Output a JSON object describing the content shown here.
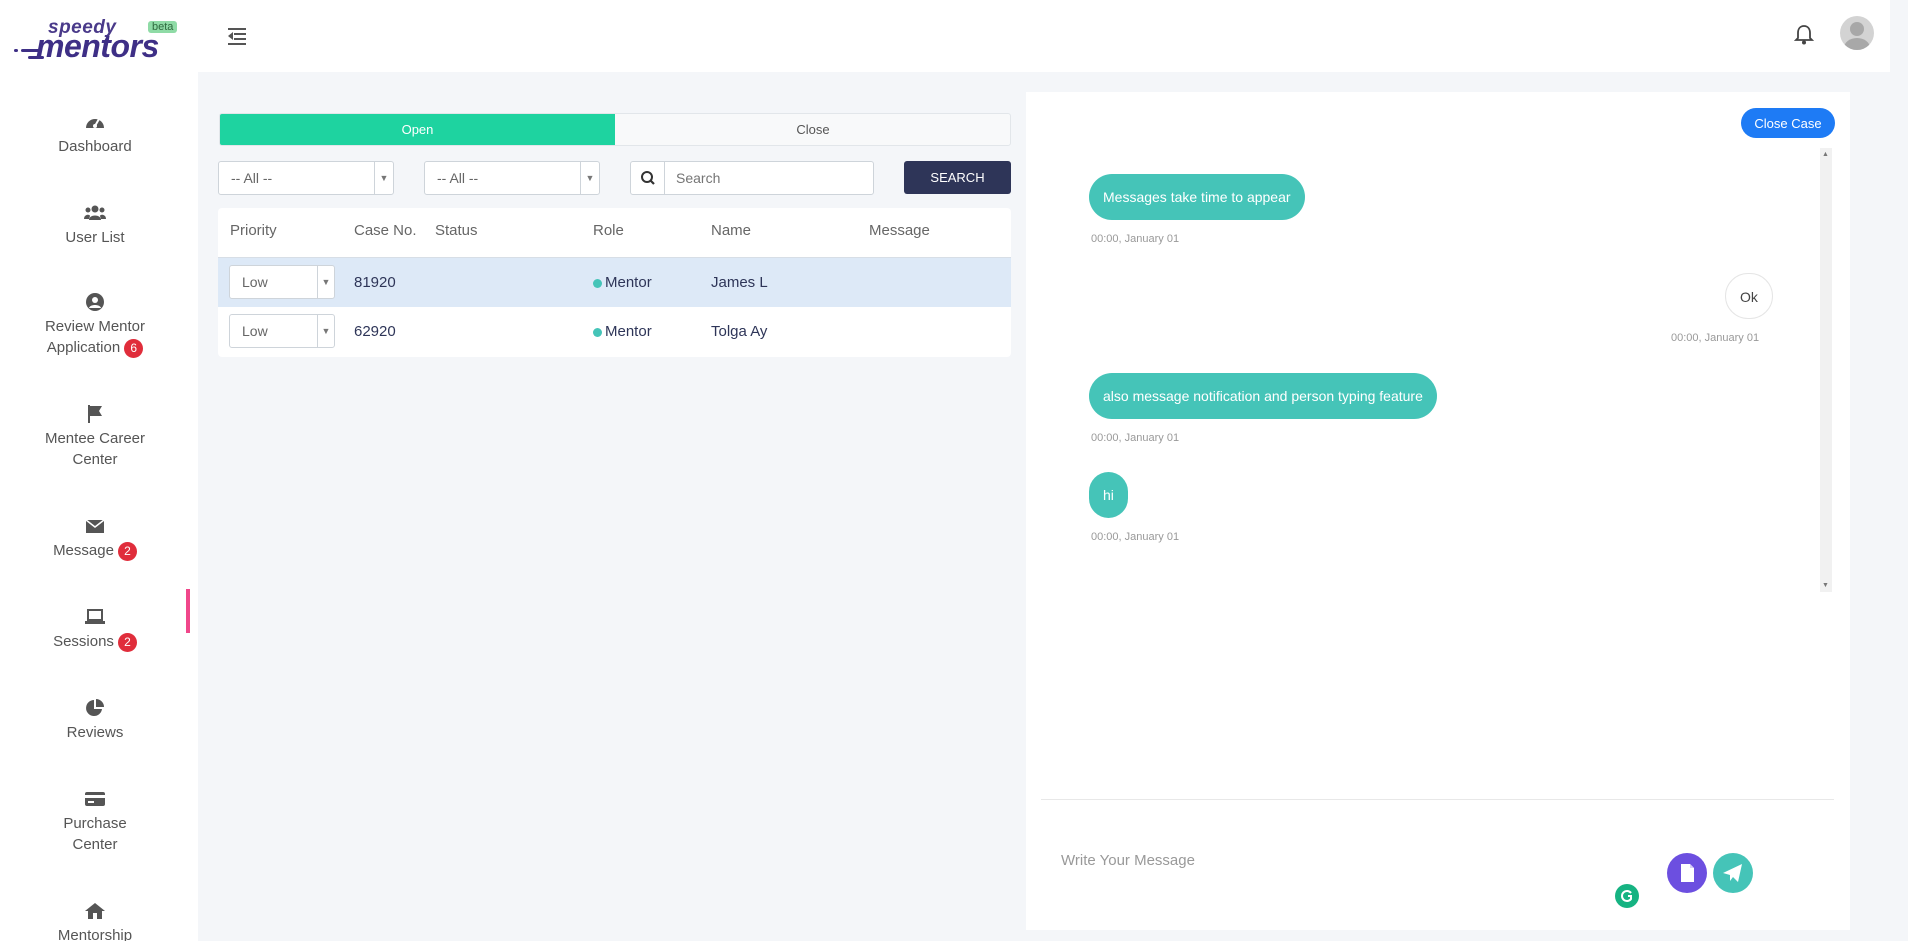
{
  "brand": {
    "logo_top": "speedy",
    "logo_main": "mentors",
    "beta_label": "beta"
  },
  "sidebar": {
    "items": [
      {
        "label": "Dashboard",
        "icon": "dashboard-icon"
      },
      {
        "label": "User List",
        "icon": "users-icon"
      },
      {
        "label": "Review Mentor Application",
        "icon": "user-circle-icon",
        "badge": "6"
      },
      {
        "label": "Mentee Career Center",
        "icon": "flag-icon"
      },
      {
        "label": "Message",
        "icon": "envelope-icon",
        "badge": "2"
      },
      {
        "label": "Sessions",
        "icon": "laptop-icon",
        "badge": "2"
      },
      {
        "label": "Reviews",
        "icon": "pie-chart-icon"
      },
      {
        "label": "Purchase Center",
        "icon": "credit-card-icon"
      },
      {
        "label": "Mentorship",
        "icon": "house-icon"
      }
    ],
    "active": "Message"
  },
  "tabs": {
    "open_label": "Open",
    "close_label": "Close",
    "active": "Open"
  },
  "filters": {
    "select1": "-- All --",
    "select2": "-- All --",
    "search_placeholder": "Search",
    "search_button": "SEARCH"
  },
  "table": {
    "headers": [
      "Priority",
      "Case No.",
      "Status",
      "Role",
      "Name",
      "Message"
    ],
    "rows": [
      {
        "priority": "Low",
        "case_no": "81920",
        "status": "",
        "role": "Mentor",
        "name": "James L",
        "message": "",
        "selected": true
      },
      {
        "priority": "Low",
        "case_no": "62920",
        "status": "",
        "role": "Mentor",
        "name": "Tolga Ay",
        "message": "",
        "selected": false
      }
    ]
  },
  "chat": {
    "close_case_label": "Close Case",
    "messages": [
      {
        "text": "Messages take time to appear",
        "time": "00:00, January 01",
        "side": "left"
      },
      {
        "text": "Ok",
        "time": "00:00, January 01",
        "side": "right"
      },
      {
        "text": "also message notification and person typing feature",
        "time": "00:00, January 01",
        "side": "left"
      },
      {
        "text": "hi",
        "time": "00:00, January 01",
        "side": "left"
      }
    ],
    "input_placeholder": "Write Your Message"
  },
  "colors": {
    "accent_green": "#1ed3a0",
    "bubble_teal": "#45c4b8",
    "navy": "#2e3558",
    "badge_red": "#e02d3b",
    "primary_blue": "#1e7bf5",
    "attach_purple": "#6c4fe0"
  }
}
